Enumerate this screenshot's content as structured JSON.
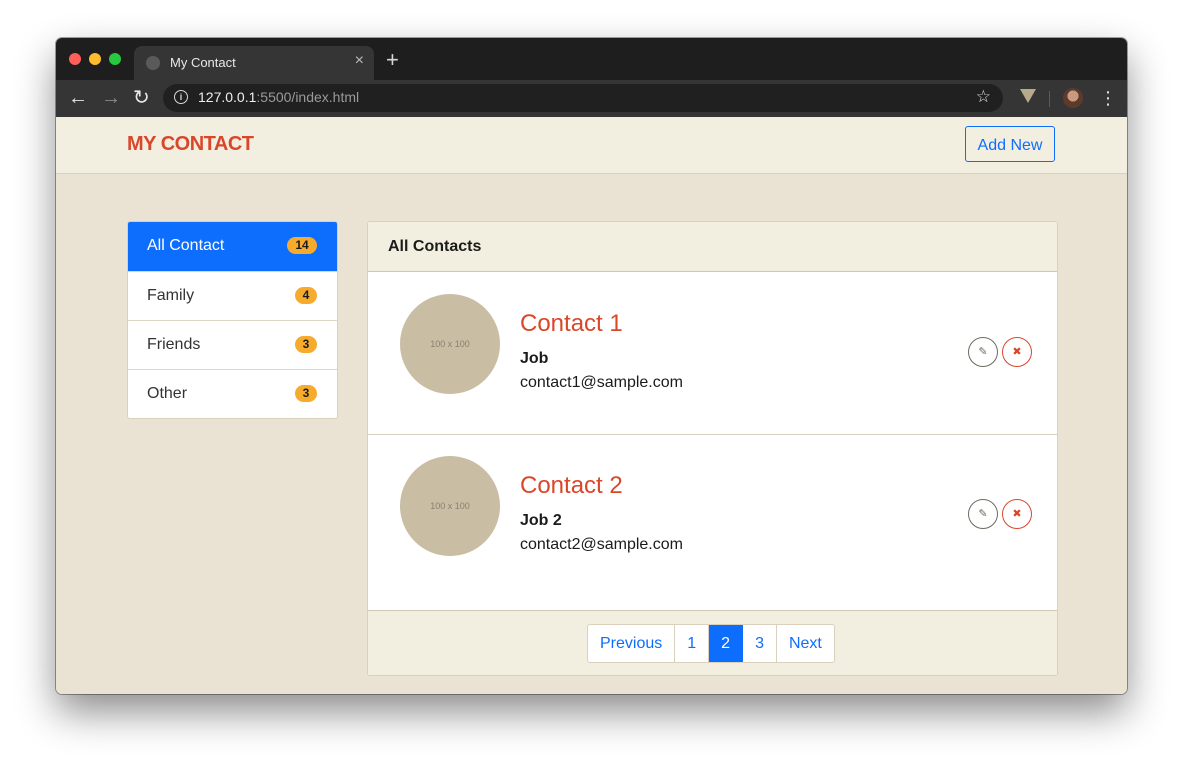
{
  "browser": {
    "tab_title": "My Contact",
    "tab_close": "×",
    "new_tab": "+",
    "back": "←",
    "forward": "→",
    "reload": "↻",
    "url_host": "127.0.0.1",
    "url_path": ":5500/index.html",
    "info_icon_glyph": "i",
    "star": "☆",
    "menu": "⋮",
    "extension_icon": "v-shield-icon"
  },
  "navbar": {
    "brand": "MY CONTACT",
    "add_new_label": "Add New"
  },
  "sidebar": {
    "items": [
      {
        "label": "All Contact",
        "count": "14",
        "active": true
      },
      {
        "label": "Family",
        "count": "4",
        "active": false
      },
      {
        "label": "Friends",
        "count": "3",
        "active": false
      },
      {
        "label": "Other",
        "count": "3",
        "active": false
      }
    ]
  },
  "panel": {
    "title": "All Contacts",
    "contacts": [
      {
        "avatar_text": "100 x 100",
        "name": "Contact 1",
        "job": "Job",
        "email": "contact1@sample.com"
      },
      {
        "avatar_text": "100 x 100",
        "name": "Contact 2",
        "job": "Job 2",
        "email": "contact2@sample.com"
      }
    ],
    "actions": {
      "edit_glyph": "✎",
      "delete_glyph": "✖"
    }
  },
  "pagination": {
    "previous": "Previous",
    "pages": [
      "1",
      "2",
      "3"
    ],
    "current": "2",
    "next": "Next"
  },
  "colors": {
    "brand": "#d9472b",
    "primary": "#0d6efd",
    "badge": "#f7ab2d",
    "page_bg": "#eae3d3",
    "header_bg": "#f3efe0"
  }
}
